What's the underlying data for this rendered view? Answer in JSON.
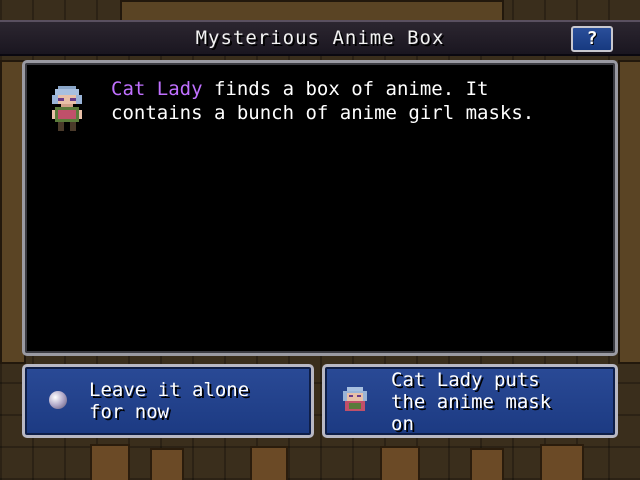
{
  "window": {
    "title": "Mysterious Anime Box",
    "help_label": "?"
  },
  "event": {
    "character_name": "Cat Lady",
    "text_line1_rest": " finds a box of anime. It",
    "text_line2": "contains a bunch of anime girl masks."
  },
  "choices": [
    {
      "line1": "Leave it alone",
      "line2": "for now",
      "icon": "orb-icon"
    },
    {
      "line1": "Cat Lady puts",
      "line2": "the anime mask",
      "line3": "on",
      "icon": "cat-lady-portrait-icon"
    }
  ],
  "colors": {
    "character_name": "#c070ff",
    "button_fill": "#1c3a82",
    "panel_fill": "#000000"
  }
}
